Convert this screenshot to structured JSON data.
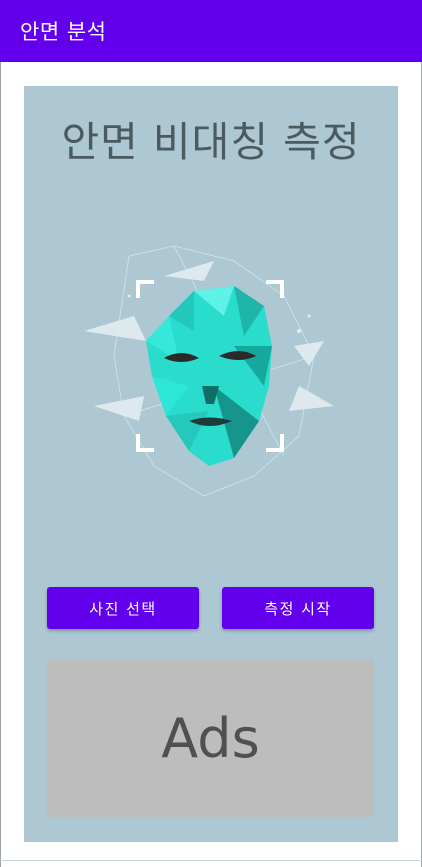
{
  "app_bar": {
    "title": "안면 분석"
  },
  "main": {
    "heading": "안면 비대칭 측정",
    "illustration": "face-scan-icon",
    "buttons": {
      "select_photo": "사진 선택",
      "start_measure": "측정 시작"
    },
    "ads": {
      "label": "Ads"
    }
  },
  "colors": {
    "accent": "#6200ee",
    "panel": "#adc8d3",
    "ads_background": "#bdbdbd",
    "face": "#2fe0d2"
  }
}
